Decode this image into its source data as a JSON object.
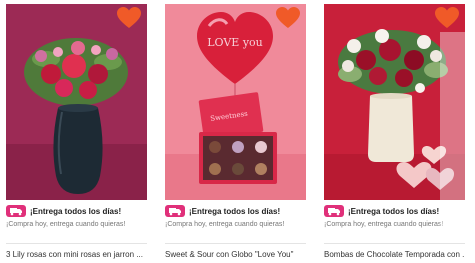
{
  "colors": {
    "favorite": "#f05a28",
    "card1_bg": "#9c2a55",
    "card2_bg": "#f08a9a",
    "card3_bg": "#c8203a",
    "badge": "#e0307a"
  },
  "products": [
    {
      "image_icon": "bouquet-vase-image",
      "favorite_icon": "heart-icon",
      "delivery_icon": "truck-badge-icon",
      "delivery_title": "¡Entrega todos los días!",
      "delivery_subtitle": "¡Compra hoy, entrega cuando quieras!",
      "name": "3 Lily rosas con mini rosas en jarron ..."
    },
    {
      "image_icon": "chocolate-box-balloon-image",
      "favorite_icon": "heart-icon",
      "delivery_icon": "truck-badge-icon",
      "delivery_title": "¡Entrega todos los días!",
      "delivery_subtitle": "¡Compra hoy, entrega cuando quieras!",
      "name": "Sweet & Sour con Globo \"Love You\""
    },
    {
      "image_icon": "roses-bouquet-chocolates-image",
      "favorite_icon": "heart-icon",
      "delivery_icon": "truck-badge-icon",
      "delivery_title": "¡Entrega todos los días!",
      "delivery_subtitle": "¡Compra hoy, entrega cuando quieras!",
      "name": "Bombas de Chocolate Temporada con ..."
    }
  ],
  "balloon_text": "LOVE you",
  "box_lid_text": "Sweetness"
}
